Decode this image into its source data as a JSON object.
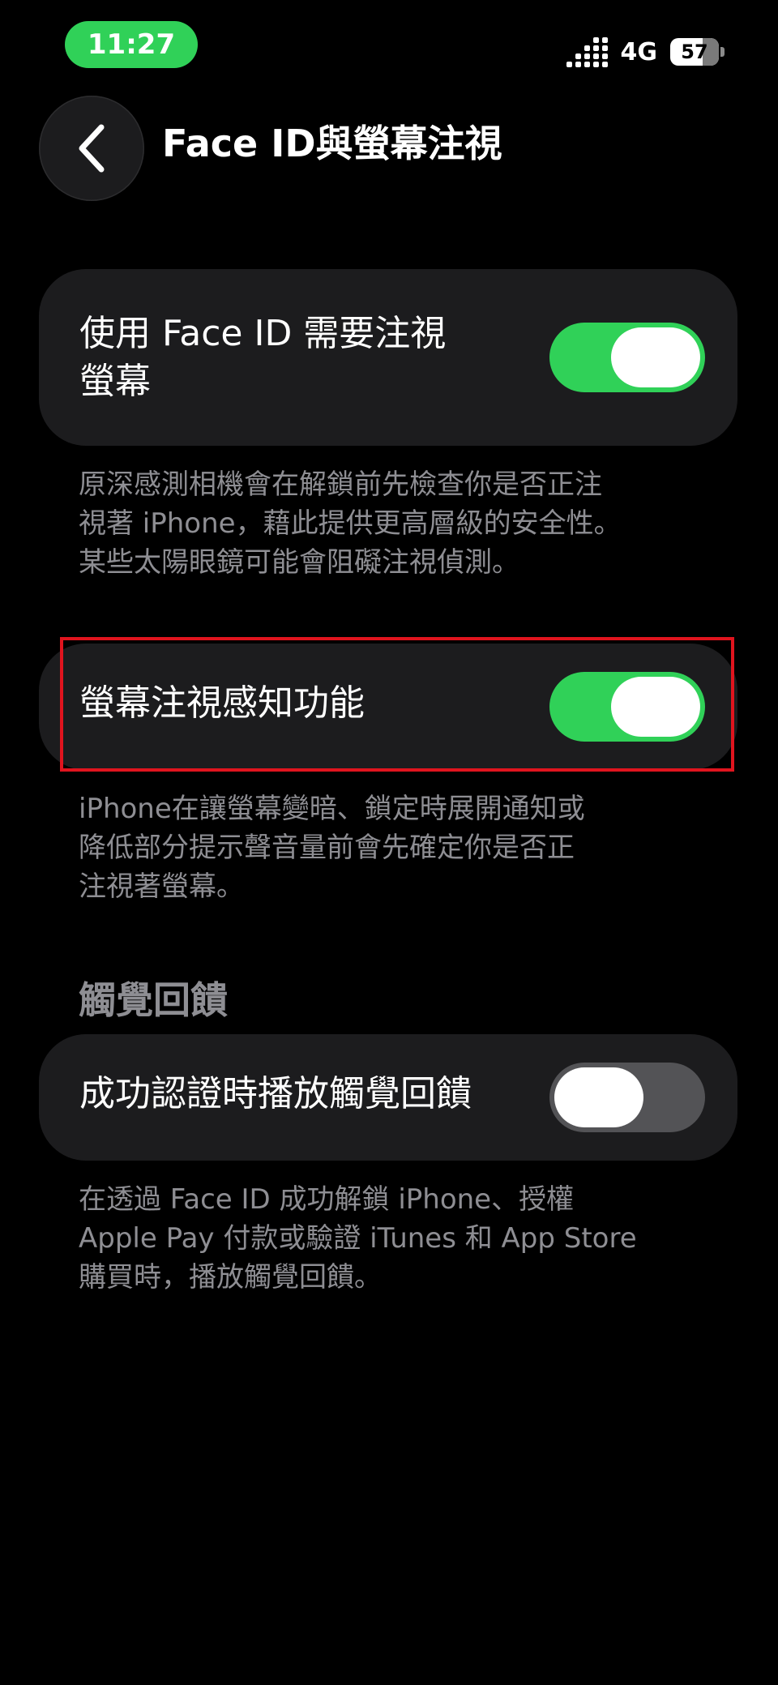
{
  "status_bar": {
    "time": "11:27",
    "network": "4G",
    "battery": "57"
  },
  "nav": {
    "title": "Face ID與螢幕注視",
    "back_icon": "chevron-left-icon"
  },
  "settings": {
    "require_attention": {
      "label_lines": [
        "使用 Face ID 需要注視",
        "螢幕"
      ],
      "enabled": true,
      "footnote_lines": [
        "原深感測相機會在解鎖前先檢查你是否正注",
        "視著 iPhone，藉此提供更高層級的安全性。",
        "某些太陽眼鏡可能會阻礙注視偵測。"
      ]
    },
    "attention_aware": {
      "label": "螢幕注視感知功能",
      "enabled": true,
      "footnote_lines": [
        "iPhone在讓螢幕變暗、鎖定時展開通知或",
        "降低部分提示聲音量前會先確定你是否正",
        "注視著螢幕。"
      ]
    },
    "haptic_section": {
      "header": "觸覺回饋",
      "label": "成功認證時播放觸覺回饋",
      "enabled": false,
      "footnote_lines": [
        "在透過 Face ID 成功解鎖 iPhone、授權",
        "Apple Pay 付款或驗證 iTunes 和 App Store",
        "購買時，播放觸覺回饋。"
      ]
    }
  },
  "colors": {
    "toggle_on": "#30d158",
    "toggle_off": "#535356",
    "card_bg": "#1c1c1e",
    "secondary_text": "#8e8e93",
    "highlight": "#e0141e"
  }
}
